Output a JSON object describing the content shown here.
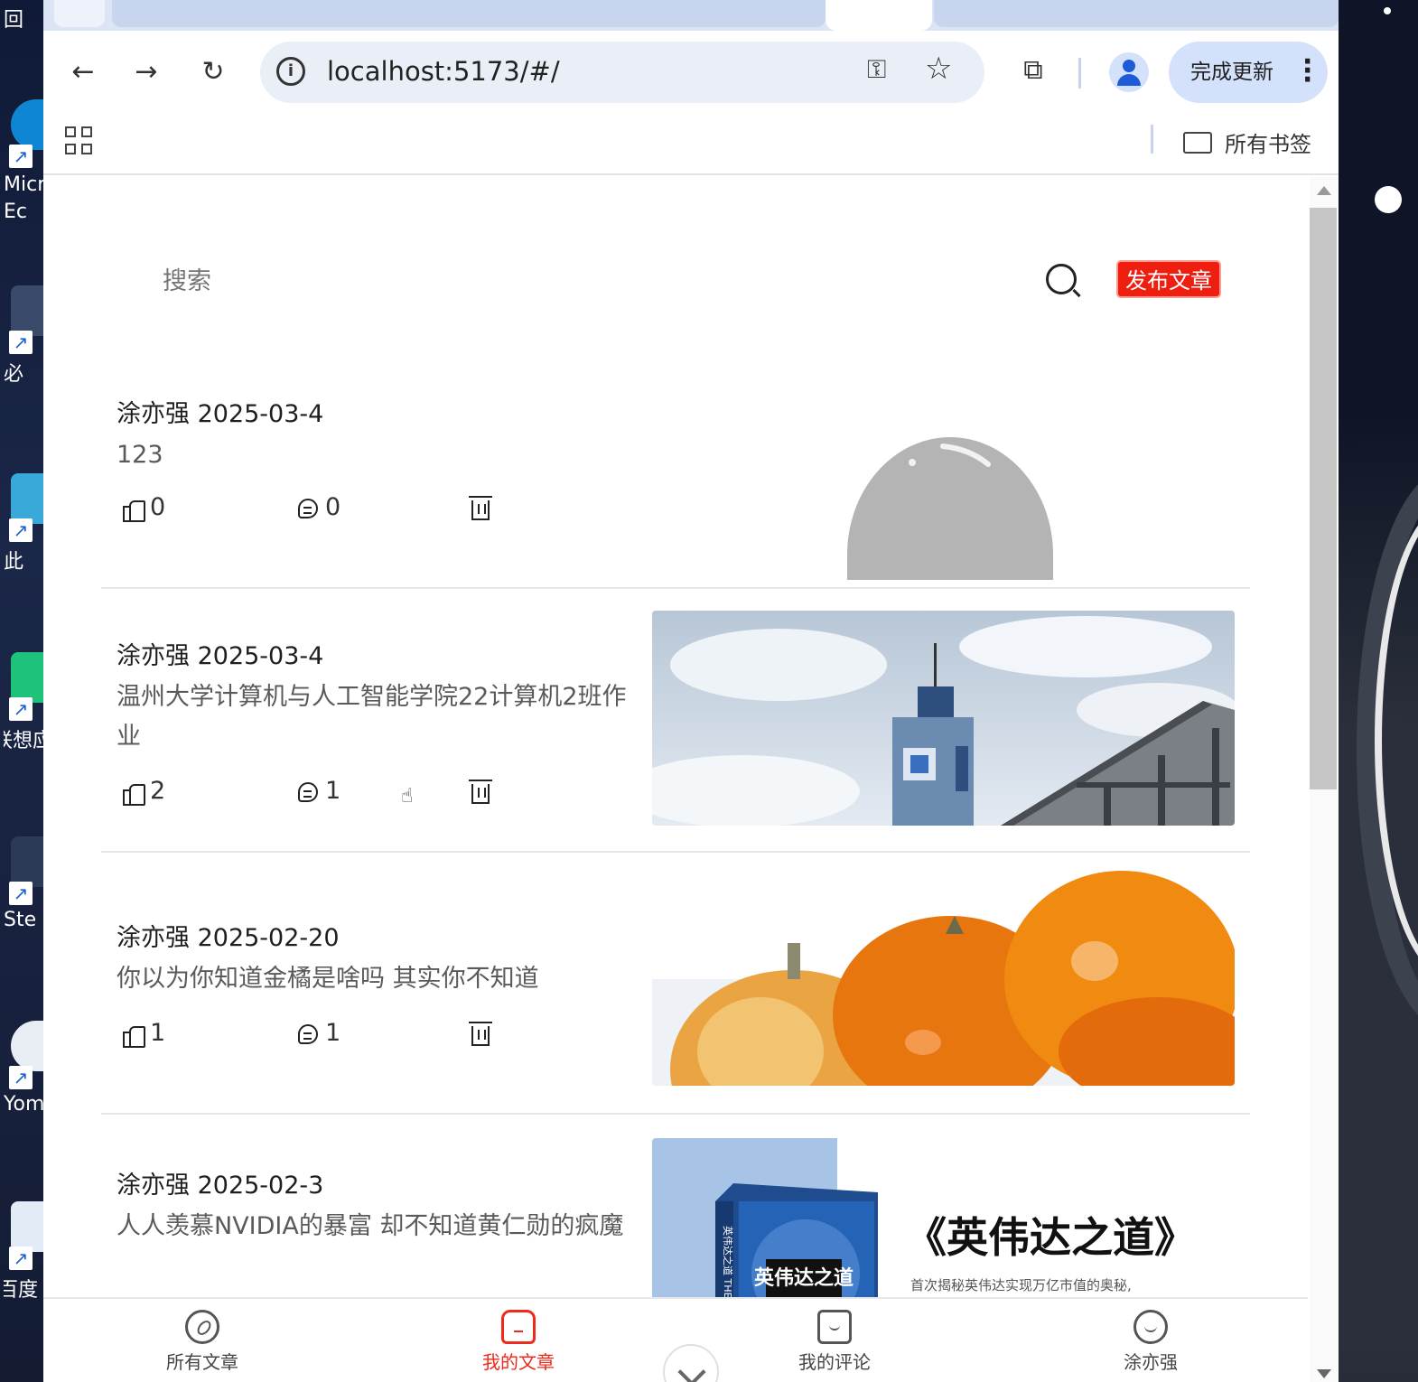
{
  "desktop": {
    "icons": [
      {
        "label": "Micr Ec",
        "color": "#0e86d4"
      },
      {
        "label": "必",
        "color": "#3a4a6a"
      },
      {
        "label": "此",
        "color": "#38a9d9"
      },
      {
        "label": "联想应",
        "color": "#1ec27a"
      },
      {
        "label": "Ste",
        "color": "#2b3a55"
      },
      {
        "label": "Yom",
        "color": "#e9eef5"
      },
      {
        "label": "百度",
        "color": "#e3ecf6"
      }
    ],
    "recycle_bin_label": "回"
  },
  "browser": {
    "url": "localhost:5173/#/",
    "update_button_label": "完成更新",
    "bookmarks_label": "所有书签"
  },
  "page": {
    "search": {
      "placeholder": "搜索"
    },
    "publish_button_label": "发布文章",
    "articles": [
      {
        "author": "涂亦强",
        "date": "2025-03-4",
        "title": "123",
        "likes": "0",
        "comments": "0",
        "image": "placeholder"
      },
      {
        "author": "涂亦强",
        "date": "2025-03-4",
        "title": "温州大学计算机与人工智能学院22计算机2班作业",
        "likes": "2",
        "comments": "1",
        "image": "campus-tower"
      },
      {
        "author": "涂亦强",
        "date": "2025-02-20",
        "title": "你以为你知道金橘是啥吗 其实你不知道",
        "likes": "1",
        "comments": "1",
        "image": "oranges"
      },
      {
        "author": "涂亦强",
        "date": "2025-02-3",
        "title": "人人羡慕NVIDIA的暴富 却不知道黄仁勋的疯魔",
        "likes": "",
        "comments": "",
        "image": "book-cover"
      }
    ],
    "book_cover": {
      "title": "《英伟达之道》",
      "subtitle": "首次揭秘英伟达实现万亿市值的奥秘,",
      "book_text": "英伟达之道",
      "spine_text": "英伟达之道 THE N"
    },
    "tabbar": {
      "items": [
        {
          "label": "所有文章",
          "icon": "compass-icon"
        },
        {
          "label": "我的文章",
          "icon": "home-icon",
          "active": true
        },
        {
          "label": "我的评论",
          "icon": "chat-icon"
        },
        {
          "label": "涂亦强",
          "icon": "user-icon"
        }
      ]
    }
  },
  "colors": {
    "accent": "#ee1f11",
    "active_tab": "#ee2a1a",
    "omnibox_bg": "#e9eef7",
    "tabstrip_bg": "#dbe5f6"
  }
}
